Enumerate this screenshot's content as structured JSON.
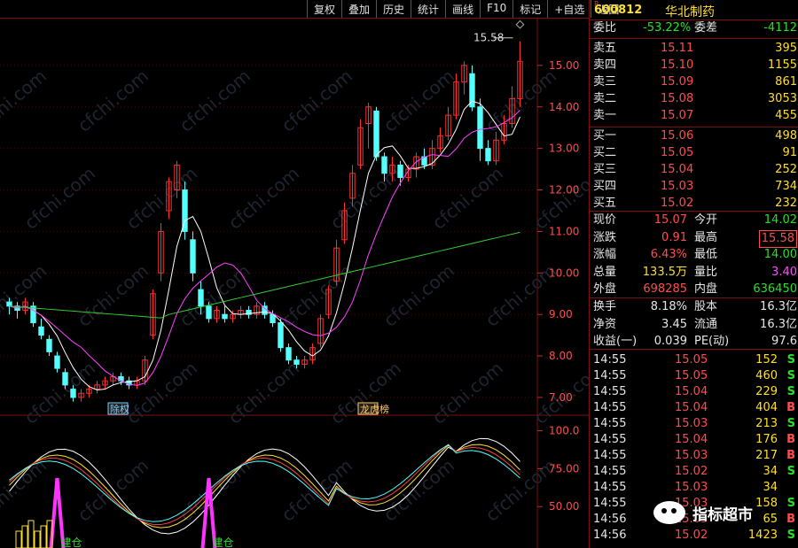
{
  "toolbar": {
    "buttons": [
      "复权",
      "叠加",
      "历史",
      "统计",
      "画线",
      "F10",
      "标记",
      "+自选",
      "返回"
    ]
  },
  "chart": {
    "high_marker": "15.58",
    "price_axis": [
      "15.00",
      "14.00",
      "13.00",
      "12.00",
      "11.00",
      "10.00",
      "9.00",
      "8.00",
      "7.00"
    ],
    "indicator_axis": [
      "100.0",
      "75.00",
      "50.00"
    ],
    "event_tags": [
      "除权",
      "龙虎榜"
    ],
    "signal_tags": [
      "建仓",
      "建仓"
    ],
    "watermark_repeats": "cfchi.com",
    "colors": {
      "up": "#ff3030",
      "down": "#54ffff",
      "ma5": "#ffffff",
      "ma10": "#ff40ff",
      "ma30": "#33cc33"
    }
  },
  "chart_data": {
    "type": "candlestick",
    "ylim": [
      6.7,
      16.0
    ],
    "candles": [
      [
        9.3,
        9.2,
        9.4,
        9.0
      ],
      [
        9.2,
        9.1,
        9.3,
        8.9
      ],
      [
        9.1,
        9.3,
        9.4,
        9.0
      ],
      [
        9.2,
        8.8,
        9.3,
        8.7
      ],
      [
        8.7,
        8.5,
        8.9,
        8.4
      ],
      [
        8.4,
        8.1,
        8.5,
        8.0
      ],
      [
        8.0,
        7.7,
        8.1,
        7.6
      ],
      [
        7.6,
        7.3,
        7.7,
        7.2
      ],
      [
        7.2,
        7.0,
        7.3,
        6.9
      ],
      [
        7.0,
        7.1,
        7.2,
        6.9
      ],
      [
        7.1,
        7.2,
        7.3,
        7.0
      ],
      [
        7.2,
        7.3,
        7.4,
        7.1
      ],
      [
        7.3,
        7.4,
        7.5,
        7.2
      ],
      [
        7.4,
        7.5,
        7.6,
        7.3
      ],
      [
        7.5,
        7.4,
        7.6,
        7.3
      ],
      [
        7.4,
        7.3,
        7.5,
        7.2
      ],
      [
        7.3,
        7.4,
        7.5,
        7.2
      ],
      [
        7.4,
        7.9,
        8.0,
        7.3
      ],
      [
        8.5,
        9.5,
        9.6,
        8.4
      ],
      [
        10.0,
        11.0,
        11.2,
        9.8
      ],
      [
        11.5,
        12.2,
        12.3,
        11.3
      ],
      [
        12.0,
        12.6,
        12.7,
        11.8
      ],
      [
        12.0,
        11.0,
        12.2,
        10.8
      ],
      [
        10.8,
        10.0,
        11.0,
        9.8
      ],
      [
        9.6,
        9.2,
        9.8,
        9.0
      ],
      [
        9.2,
        8.9,
        9.3,
        8.8
      ],
      [
        8.9,
        9.1,
        9.2,
        8.8
      ],
      [
        9.0,
        8.9,
        9.2,
        8.8
      ],
      [
        8.9,
        9.0,
        9.1,
        8.8
      ],
      [
        9.0,
        9.1,
        9.2,
        8.9
      ],
      [
        9.1,
        9.0,
        9.2,
        8.9
      ],
      [
        9.0,
        9.2,
        9.3,
        8.9
      ],
      [
        9.2,
        9.0,
        9.3,
        8.9
      ],
      [
        9.0,
        8.8,
        9.1,
        8.7
      ],
      [
        8.8,
        8.2,
        8.9,
        8.1
      ],
      [
        8.2,
        7.9,
        8.3,
        7.8
      ],
      [
        7.9,
        7.8,
        8.0,
        7.7
      ],
      [
        7.8,
        7.9,
        8.0,
        7.7
      ],
      [
        7.9,
        8.2,
        8.3,
        7.8
      ],
      [
        8.3,
        8.9,
        9.0,
        8.2
      ],
      [
        9.0,
        9.6,
        9.7,
        8.9
      ],
      [
        9.8,
        10.6,
        10.8,
        9.7
      ],
      [
        10.8,
        11.5,
        11.7,
        10.7
      ],
      [
        11.8,
        12.4,
        12.6,
        11.6
      ],
      [
        12.6,
        13.5,
        13.7,
        12.5
      ],
      [
        13.6,
        14.0,
        14.1,
        13.0
      ],
      [
        13.9,
        12.8,
        14.0,
        12.7
      ],
      [
        12.8,
        12.4,
        12.9,
        12.2
      ],
      [
        12.4,
        12.6,
        12.8,
        12.2
      ],
      [
        12.6,
        12.3,
        12.7,
        12.1
      ],
      [
        12.3,
        12.5,
        12.6,
        12.2
      ],
      [
        12.5,
        12.8,
        12.9,
        12.3
      ],
      [
        12.8,
        12.6,
        13.0,
        12.5
      ],
      [
        12.6,
        13.0,
        13.2,
        12.5
      ],
      [
        13.0,
        13.3,
        13.5,
        12.9
      ],
      [
        13.3,
        13.8,
        14.0,
        13.2
      ],
      [
        13.8,
        14.6,
        14.8,
        13.7
      ],
      [
        14.6,
        15.0,
        15.1,
        14.3
      ],
      [
        14.8,
        14.0,
        15.0,
        13.9
      ],
      [
        14.0,
        13.0,
        14.2,
        12.7
      ],
      [
        13.0,
        12.7,
        13.2,
        12.6
      ],
      [
        12.7,
        13.2,
        13.4,
        12.6
      ],
      [
        13.2,
        13.6,
        13.8,
        13.1
      ],
      [
        13.6,
        14.2,
        14.5,
        13.5
      ],
      [
        14.2,
        15.1,
        15.58,
        14.0
      ]
    ]
  },
  "quote": {
    "market_tag": "R",
    "code": "600812",
    "name": "华北制药",
    "weibi_label": "委比",
    "weibi": "-53.22%",
    "weicha_label": "委差",
    "weicha": "-4112",
    "asks": [
      {
        "label": "卖五",
        "price": "15.11",
        "vol": "395"
      },
      {
        "label": "卖四",
        "price": "15.10",
        "vol": "1155"
      },
      {
        "label": "卖三",
        "price": "15.09",
        "vol": "861"
      },
      {
        "label": "卖二",
        "price": "15.08",
        "vol": "3053"
      },
      {
        "label": "卖一",
        "price": "15.07",
        "vol": "455"
      }
    ],
    "bids": [
      {
        "label": "买一",
        "price": "15.06",
        "vol": "498"
      },
      {
        "label": "买二",
        "price": "15.05",
        "vol": "91"
      },
      {
        "label": "买三",
        "price": "15.04",
        "vol": "252"
      },
      {
        "label": "买四",
        "price": "15.03",
        "vol": "734"
      },
      {
        "label": "买五",
        "price": "15.02",
        "vol": "232"
      }
    ],
    "stats": [
      {
        "l1": "现价",
        "v1": "15.07",
        "l2": "今开",
        "v2": "14.02"
      },
      {
        "l1": "涨跌",
        "v1": "0.91",
        "l2": "最高",
        "v2": "15.58"
      },
      {
        "l1": "涨幅",
        "v1": "6.43%",
        "l2": "最低",
        "v2": "14.00"
      },
      {
        "l1": "总量",
        "v1": "133.5万",
        "l2": "量比",
        "v2": "3.40"
      },
      {
        "l1": "外盘",
        "v1": "698285",
        "l2": "内盘",
        "v2": "636450"
      }
    ],
    "stats2": [
      {
        "l1": "换手",
        "v1": "8.18%",
        "l2": "股本",
        "v2": "16.3亿"
      },
      {
        "l1": "净资",
        "v1": "3.45",
        "l2": "流通",
        "v2": "16.3亿"
      },
      {
        "l1": "收益(一)",
        "v1": "0.039",
        "l2": "PE(动)",
        "v2": "97.6"
      }
    ],
    "ticks": [
      {
        "t": "14:55",
        "p": "15.05",
        "v": "152",
        "s": "S"
      },
      {
        "t": "14:55",
        "p": "15.05",
        "v": "460",
        "s": "S"
      },
      {
        "t": "14:55",
        "p": "15.04",
        "v": "229",
        "s": "S"
      },
      {
        "t": "14:55",
        "p": "15.04",
        "v": "404",
        "s": "B"
      },
      {
        "t": "14:55",
        "p": "15.03",
        "v": "213",
        "s": "S"
      },
      {
        "t": "14:55",
        "p": "15.04",
        "v": "176",
        "s": "B"
      },
      {
        "t": "14:55",
        "p": "15.03",
        "v": "217",
        "s": "B"
      },
      {
        "t": "14:55",
        "p": "15.02",
        "v": "34",
        "s": "S"
      },
      {
        "t": "14:55",
        "p": "15.03",
        "v": "34",
        "s": ""
      },
      {
        "t": "14:55",
        "p": "15.03",
        "v": "158",
        "s": "S"
      },
      {
        "t": "14:56",
        "p": "15.03",
        "v": "65",
        "s": "B"
      },
      {
        "t": "14:56",
        "p": "15.02",
        "v": "1423",
        "s": "S"
      }
    ]
  },
  "overlay_watermark": "指标超市"
}
